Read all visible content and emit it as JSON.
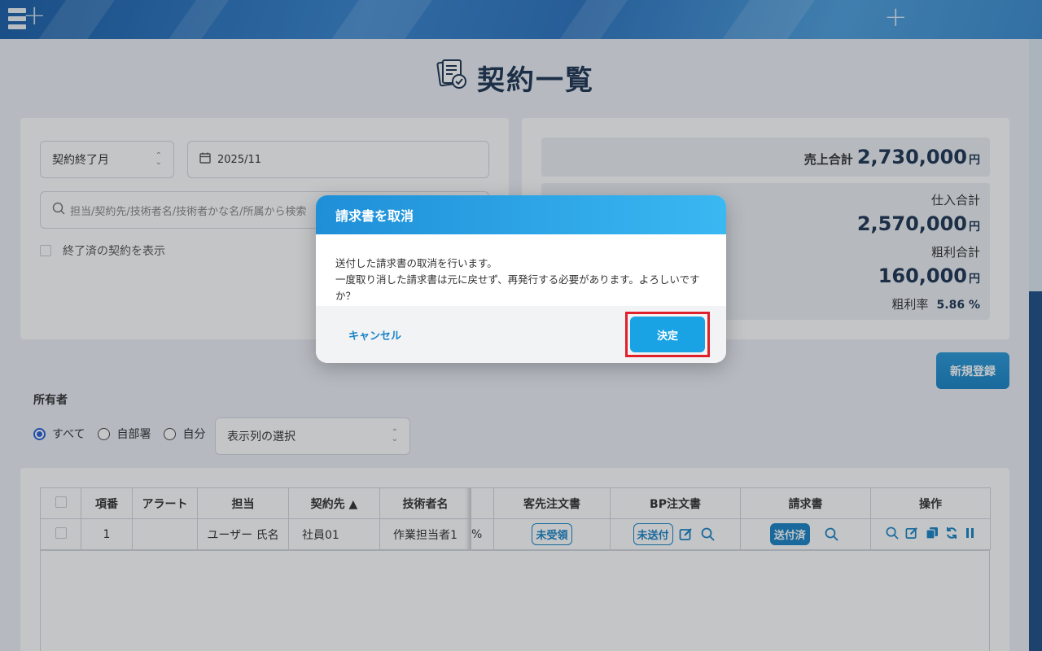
{
  "page": {
    "title": "契約一覧"
  },
  "filter": {
    "date_type": "契約終了月",
    "month": "2025/11",
    "search_placeholder": "担当/契約先/技術者名/技術者かな名/所属から検索",
    "show_finished_label": "終了済の契約を表示"
  },
  "summary": {
    "sales_label": "売上合計",
    "sales_value": "2,730,000",
    "yen": "円",
    "purchase_label": "仕入合計",
    "purchase_value": "2,570,000",
    "profit_label": "粗利合計",
    "profit_value": "160,000",
    "margin_label": "粗利率",
    "margin_value": "5.86 %"
  },
  "new_button": "新規登録",
  "owner": {
    "label": "所有者",
    "options": [
      "すべて",
      "自部署",
      "自分"
    ],
    "selected": "すべて",
    "columns_select": "表示列の選択"
  },
  "table": {
    "headers": [
      "",
      "項番",
      "アラート",
      "担当",
      "契約先 ▲",
      "技術者名",
      "",
      "客先注文書",
      "BP注文書",
      "請求書",
      "操作"
    ],
    "rows": [
      {
        "no": "1",
        "alert": "",
        "owner": "ユーザー 氏名",
        "client": "社員01",
        "engineer": "作業担当者1",
        "rate": "%",
        "customer_order": "未受領",
        "bp_order": "未送付",
        "invoice": "送付済"
      }
    ]
  },
  "dialog": {
    "title": "請求書を取消",
    "line1": "送付した請求書の取消を行います。",
    "line2": "一度取り消した請求書は元に戻せず、再発行する必要があります。よろしいですか？",
    "cancel": "キャンセル",
    "confirm": "決定"
  },
  "colors": {
    "accent": "#1a84c6",
    "highlight": "#e0202a",
    "dialog_head": "#2aa6ea"
  }
}
